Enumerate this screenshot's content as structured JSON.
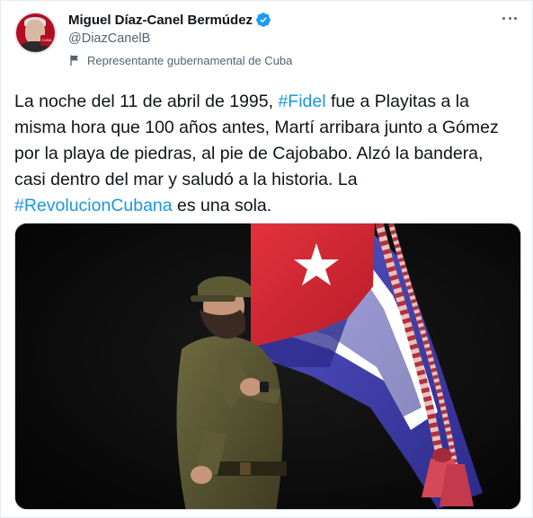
{
  "author": {
    "display_name": "Miguel Díaz-Canel Bermúdez",
    "handle": "@DiazCanelB",
    "verified": true,
    "label": "Representante gubernamental de Cuba",
    "avatar_badge_text": "CUBA VIVE"
  },
  "tweet": {
    "segments": [
      {
        "text": "La noche del 11 de abril de 1995, ",
        "type": "text"
      },
      {
        "text": "#Fidel",
        "type": "hashtag"
      },
      {
        "text": " fue a Playitas a la misma hora que 100 años antes, Martí arribara junto a Gómez por la playa de piedras, al pie de Cajobabo. Alzó la bandera, casi dentro del mar y saludó a la historia. La ",
        "type": "text"
      },
      {
        "text": "#RevolucionCubana",
        "type": "hashtag"
      },
      {
        "text": " es una sola.",
        "type": "text"
      }
    ]
  },
  "icons": {
    "verified": "verified-badge-icon",
    "label": "flag-icon",
    "more": "more-options-icon"
  },
  "colors": {
    "hashtag": "#1b95e0",
    "verified": "#1d9bf0",
    "secondary_text": "#536471",
    "flag_red": "#d4232f",
    "flag_blue": "#3d3ba8"
  }
}
